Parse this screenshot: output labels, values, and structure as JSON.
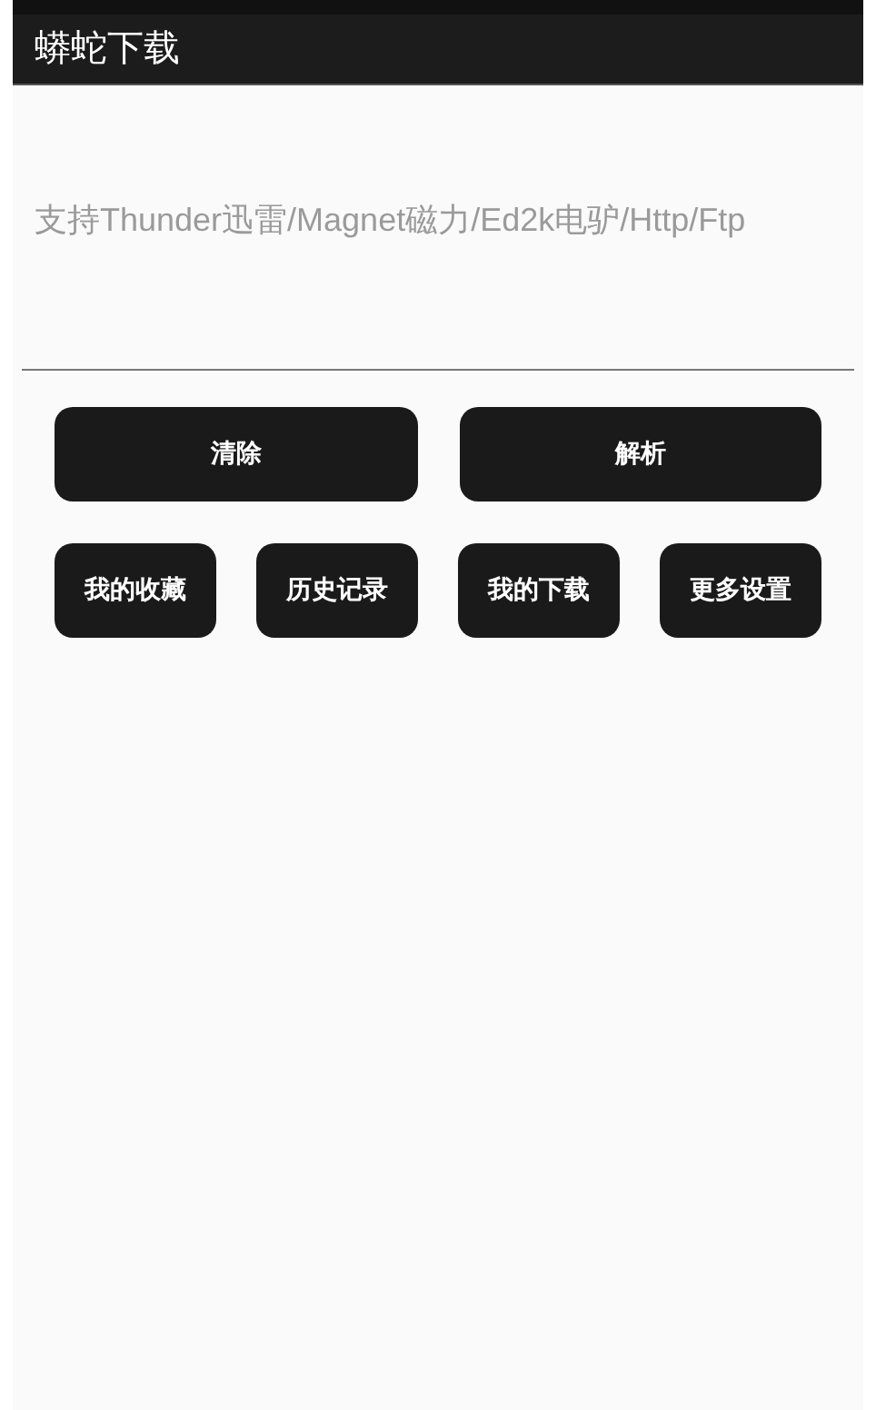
{
  "app_bar": {
    "title": "蟒蛇下载"
  },
  "link_field": {
    "placeholder": "支持Thunder迅雷/Magnet磁力/Ed2k电驴/Http/Ftp"
  },
  "primary_buttons": [
    {
      "label": "清除"
    },
    {
      "label": "解析"
    }
  ],
  "secondary_buttons": [
    {
      "label": "我的收藏"
    },
    {
      "label": "历史记录"
    },
    {
      "label": "我的下载"
    },
    {
      "label": "更多设置"
    }
  ]
}
